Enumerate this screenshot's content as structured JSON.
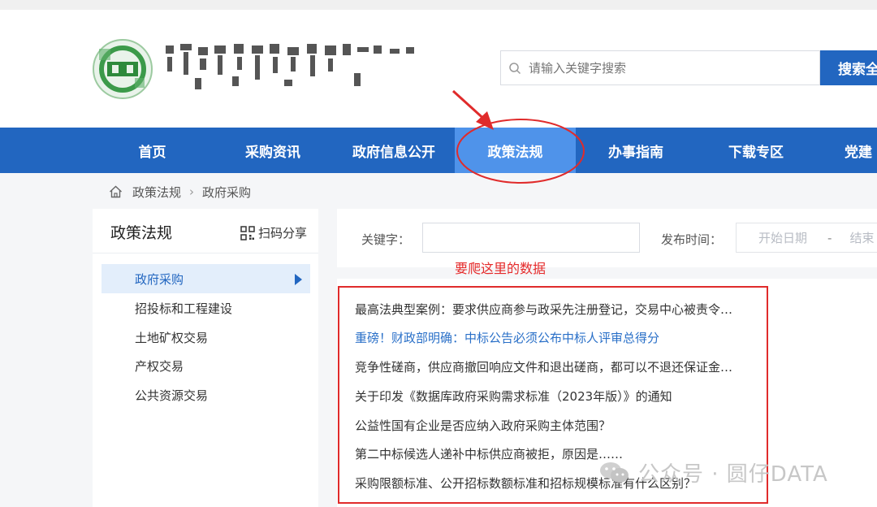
{
  "header": {
    "logo_icon": "agency-emblem-icon",
    "search": {
      "placeholder": "请输入关键字搜索",
      "button_label": "搜索全"
    }
  },
  "nav": {
    "items": [
      {
        "label": "首页"
      },
      {
        "label": "采购资讯"
      },
      {
        "label": "政府信息公开"
      },
      {
        "label": "政策法规"
      },
      {
        "label": "办事指南"
      },
      {
        "label": "下载专区"
      },
      {
        "label": "党建"
      }
    ],
    "active_index": 3,
    "bg_color": "#2266c0",
    "active_color": "#4f93ea"
  },
  "breadcrumb": {
    "items": [
      "政策法规",
      "政府采购"
    ]
  },
  "sidebar": {
    "title": "政策法规",
    "share_label": "扫码分享",
    "items": [
      {
        "label": "政府采购"
      },
      {
        "label": "招投标和工程建设"
      },
      {
        "label": "土地矿权交易"
      },
      {
        "label": "产权交易"
      },
      {
        "label": "公共资源交易"
      }
    ],
    "active_index": 0
  },
  "filter": {
    "keyword_label": "关键字：",
    "keyword_value": "",
    "date_label": "发布时间：",
    "start_placeholder": "开始日期",
    "separator": "-",
    "end_placeholder": "结束"
  },
  "annotation": {
    "text": "要爬这里的数据",
    "color": "#e02b2b"
  },
  "articles": [
    {
      "title": "最高法典型案例：要求供应商参与政采先注册登记，交易中心被责令…"
    },
    {
      "title": "重磅！财政部明确：中标公告必须公布中标人评审总得分"
    },
    {
      "title": "竞争性磋商，供应商撤回响应文件和退出磋商，都可以不退还保证金…"
    },
    {
      "title": "关于印发《数据库政府采购需求标准（2023年版）》的通知"
    },
    {
      "title": "公益性国有企业是否应纳入政府采购主体范围？"
    },
    {
      "title": "第二中标候选人递补中标供应商被拒，原因是……"
    },
    {
      "title": "采购限额标准、公开招标数额标准和招标规模标准有什么区别？"
    }
  ],
  "watermark": {
    "icon": "wechat-icon",
    "text": "公众号 · 圆仔DATA"
  }
}
